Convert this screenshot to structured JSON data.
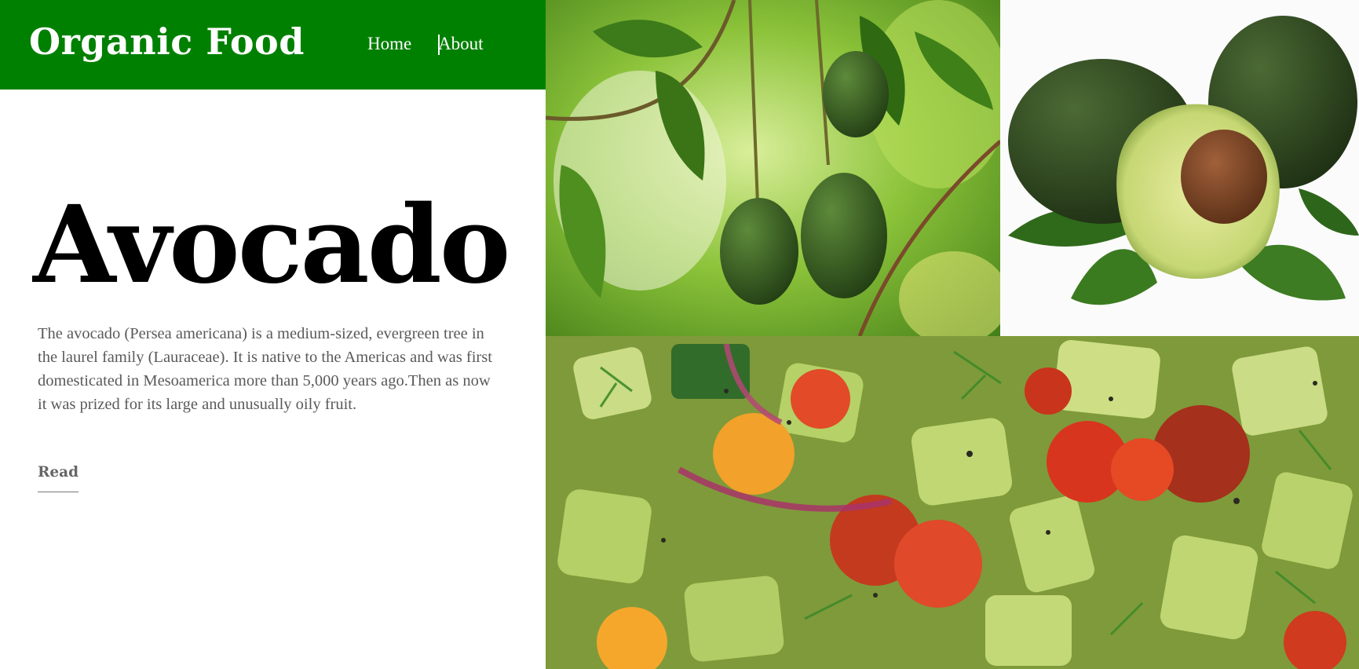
{
  "header": {
    "brand": "Organic Food",
    "nav": {
      "home": "Home",
      "about": "About"
    }
  },
  "hero": {
    "title": "Avocado",
    "description": "The avocado (Persea americana) is a medium-sized, evergreen tree in the laurel family (Lauraceae). It is native to the Americas and was first domesticated in Mesoamerica more than 5,000 years ago.Then as now it was prized for its large and unusually oily fruit.",
    "read_label": "Read"
  },
  "colors": {
    "header_bg": "#008000",
    "title": "#000000",
    "body_text": "#5a5a5a"
  },
  "gallery": {
    "images": [
      {
        "name": "avocado-tree-photo",
        "subject": "avocados hanging on a tree branch"
      },
      {
        "name": "avocado-halves-photo",
        "subject": "whole and halved avocados with leaves"
      },
      {
        "name": "avocado-salad-photo",
        "subject": "avocado salad with tomatoes, cucumber and herbs"
      }
    ]
  }
}
